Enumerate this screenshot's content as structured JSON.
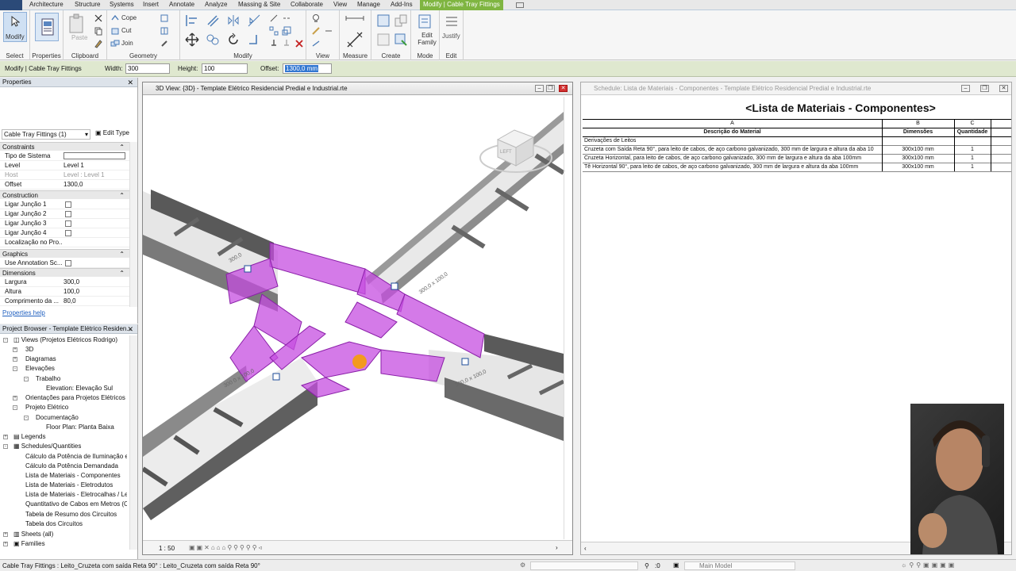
{
  "tabs": [
    {
      "label": "Architecture"
    },
    {
      "label": "Structure"
    },
    {
      "label": "Systems"
    },
    {
      "label": "Insert"
    },
    {
      "label": "Annotate"
    },
    {
      "label": "Analyze"
    },
    {
      "label": "Massing & Site"
    },
    {
      "label": "Collaborate"
    },
    {
      "label": "View"
    },
    {
      "label": "Manage"
    },
    {
      "label": "Add-Ins"
    },
    {
      "label": "Modify | Cable Tray Fittings"
    }
  ],
  "ribbon": {
    "modify_label": "Modify",
    "select_label": "Select",
    "properties_label": "Properties",
    "paste_label": "Paste",
    "cope_label": "Cope",
    "cut_label": "Cut",
    "join_label": "Join",
    "clipboard_label": "Clipboard",
    "geometry_label": "Geometry",
    "modify_group_label": "Modify",
    "view_label": "View",
    "measure_label": "Measure",
    "create_label": "Create",
    "edit_family_label": "Edit Family",
    "justify_label": "Justify",
    "mode_label": "Mode",
    "edit_label": "Edit"
  },
  "options_bar": {
    "context": "Modify | Cable Tray Fittings",
    "width_label": "Width:",
    "width_value": "300",
    "height_label": "Height:",
    "height_value": "100",
    "offset_label": "Offset:",
    "offset_value": "1300,0 mm"
  },
  "properties": {
    "title": "Properties",
    "type_selector": "Cable Tray Fittings (1)",
    "edit_type": "Edit Type",
    "sections": {
      "constraints": "Constraints",
      "construction": "Construction",
      "graphics": "Graphics",
      "dimensions": "Dimensions"
    },
    "rows": {
      "tipo_sistema": "Tipo de Sistema",
      "level_k": "Level",
      "level_v": "Level 1",
      "host_k": "Host",
      "host_v": "Level : Level 1",
      "offset_k": "Offset",
      "offset_v": "1300,0",
      "ligar1": "Ligar Junção 1",
      "ligar2": "Ligar Junção 2",
      "ligar3": "Ligar Junção 3",
      "ligar4": "Ligar Junção 4",
      "localizacao": "Localização no Pro...",
      "annotation": "Use Annotation Sc...",
      "largura_k": "Largura",
      "largura_v": "300,0",
      "altura_k": "Altura",
      "altura_v": "100,0",
      "comprimento_k": "Comprimento da ...",
      "comprimento_v": "80,0"
    },
    "help": "Properties help"
  },
  "browser": {
    "title": "Project Browser - Template Elétrico Residen...",
    "items": {
      "views": "Views (Projetos Elétricos Rodrigo)",
      "v3d": "3D",
      "diagramas": "Diagramas",
      "elevacoes": "Elevações",
      "trabalho": "Trabalho",
      "elev_sul": "Elevation: Elevação Sul",
      "orientacoes": "Orientações para Projetos Elétricos",
      "projeto": "Projeto Elétrico",
      "documentacao": "Documentação",
      "planta": "Floor Plan: Planta Baixa",
      "legends": "Legends",
      "schedules": "Schedules/Quantities",
      "s1": "Cálculo da Potência de Iluminação e",
      "s2": "Cálculo da Potência Demandada",
      "s3": "Lista de Materiais - Componentes",
      "s4": "Lista de Materiais - Eletrodutos",
      "s5": "Lista de Materiais - Eletrocalhas / Lei",
      "s6": "Quantitativo de Cabos em Metros (C",
      "s7": "Tabela de Resumo dos Circuitos",
      "s8": "Tabela dos Circuitos",
      "sheets": "Sheets (all)",
      "families": "Families"
    }
  },
  "view3d": {
    "title": "3D View: {3D} - Template Elétrico Residencial Predial e Industrial.rte",
    "scale": "1 : 50",
    "dims": {
      "d1": "300,0",
      "d2": "300,0 x 100,0",
      "d3": "300 0 x 100,0",
      "d4": "300,0 x 100,0"
    },
    "cube_label": "LEFT"
  },
  "schedule": {
    "window_title": "Schedule: Lista de Materiais - Componentes - Template Elétrico Residencial Predial e Industrial.rte",
    "title": "<Lista de Materiais - Componentes>",
    "col_letters": [
      "A",
      "B",
      "C"
    ],
    "headers": [
      "Descrição do Material",
      "Dimensões",
      "Quantidade"
    ],
    "group": "Derivações de Leitos",
    "rows": [
      [
        "Cruzeta com Saída Reta 90°, para leito de cabos, de aço carbono galvanizado, 300 mm de largura e altura da aba 10",
        "300x100 mm",
        "1"
      ],
      [
        "Cruzeta Horizontal, para leito de cabos, de aço carbono galvanizado, 300 mm de largura e altura da aba 100mm",
        "300x100 mm",
        "1"
      ],
      [
        "Tê Horizontal 90°, para leito de cabos, de aço carbono galvanizado, 300 mm de largura e altura da aba 100mm",
        "300x100 mm",
        "1"
      ]
    ]
  },
  "status": {
    "text": "Cable Tray Fittings : Leito_Cruzeta com saída Reta 90° : Leito_Cruzeta com saída Reta 90°",
    "zero": ":0",
    "model": "Main Model"
  },
  "colors": {
    "accent": "#7fb541",
    "selection": "#c54de0"
  }
}
